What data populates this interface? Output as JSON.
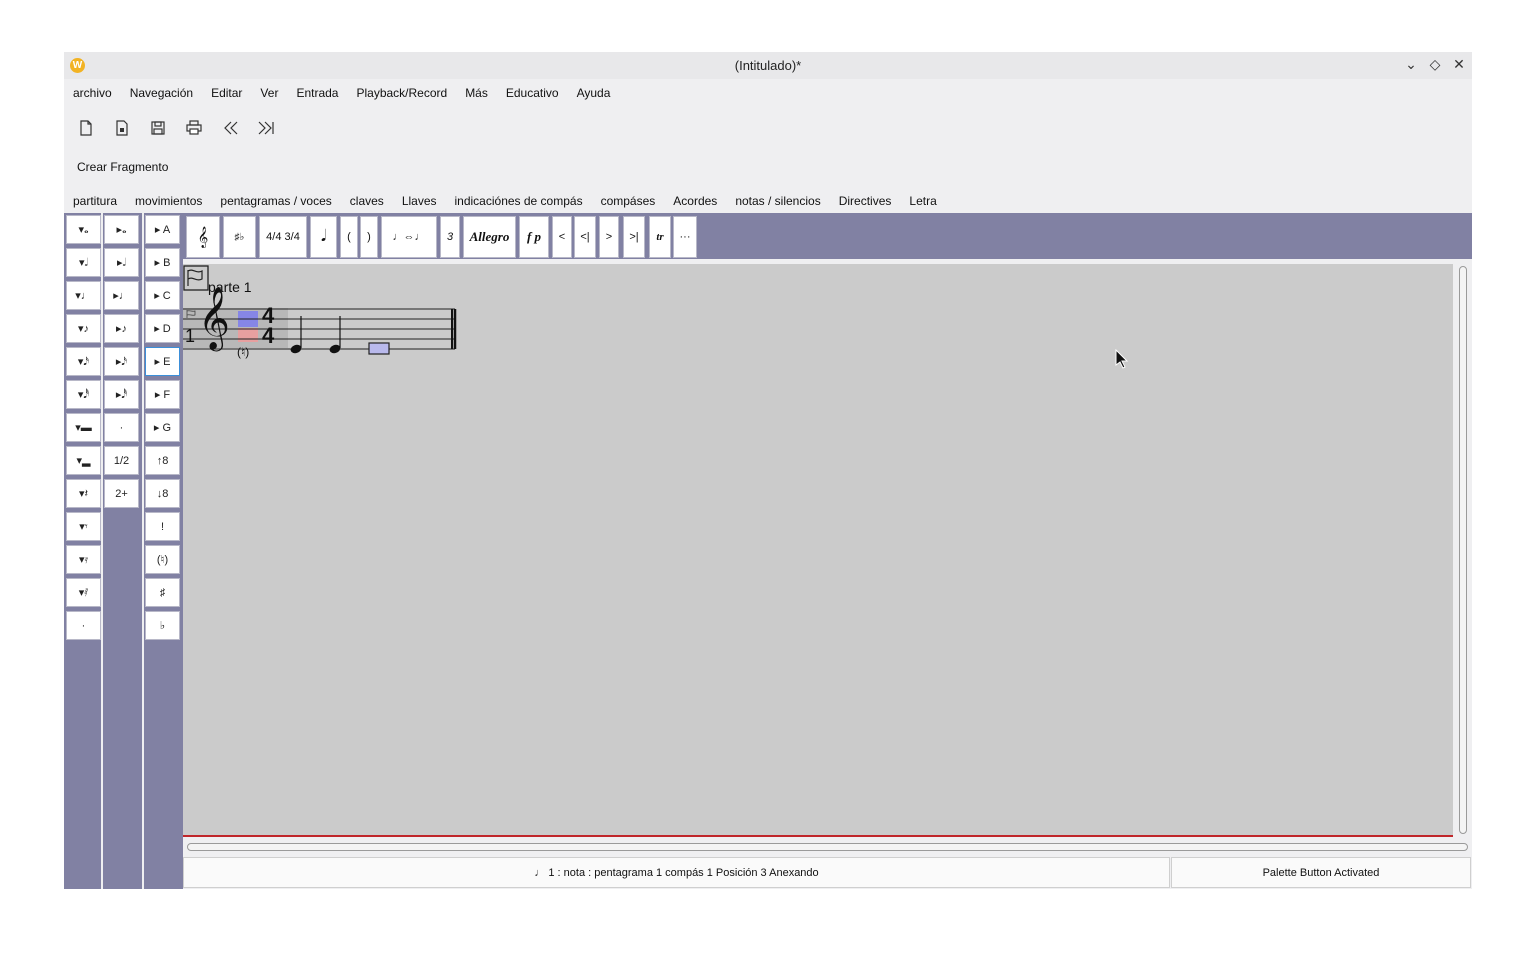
{
  "window": {
    "title": "(Intitulado)*"
  },
  "menu": [
    "archivo",
    "Navegación",
    "Editar",
    "Ver",
    "Entrada",
    "Playback/Record",
    "Más",
    "Educativo",
    "Ayuda"
  ],
  "toolbar_icons": [
    "new-file-icon",
    "open-file-icon",
    "save-icon",
    "print-icon",
    "go-first-icon",
    "go-last-icon"
  ],
  "fragment_button": "Crear Fragmento",
  "tabs": [
    "partitura",
    "movimientos",
    "pentagramas / voces",
    "claves",
    "Llaves",
    "indicaciónes de compás",
    "compáses",
    "Acordes",
    "notas / silencios",
    "Directives",
    "Letra"
  ],
  "palette": {
    "col1": [
      "▾𝅝",
      "▾𝅗𝅥",
      "▾♩",
      "▾♪",
      "▾𝅘𝅥𝅯",
      "▾𝅘𝅥𝅰",
      "▾▬",
      "▾▂",
      "▾𝄽",
      "▾𝄾",
      "▾𝄿",
      "▾𝅀",
      "·"
    ],
    "col2": [
      "▸𝅝",
      "▸𝅗𝅥",
      "▸♩",
      "▸♪",
      "▸𝅘𝅥𝅯",
      "▸𝅘𝅥𝅰",
      "·",
      "1/2",
      "2+"
    ],
    "col3": [
      "▸ A",
      "▸ B",
      "▸ C",
      "▸ D",
      "▸ E",
      "▸ F",
      "▸ G",
      "↑8",
      "↓8",
      "!",
      "(♮)",
      "♯",
      "♭"
    ]
  },
  "hpalette": [
    "𝄞",
    "♯♭",
    "4/4 3/4",
    "𝅘𝅥",
    "(",
    ")",
    "♩⇔♩",
    "3",
    "Allegro",
    "f p",
    "<",
    "<|",
    ">",
    ">|",
    "tr",
    "···"
  ],
  "score": {
    "part_label": "parte 1",
    "measure_number": "1",
    "time_sig_top": "4",
    "time_sig_bottom": "4",
    "natural_mark": "(♮)"
  },
  "status": {
    "left": "♩ 1 : nota : pentagrama 1 compás 1 Posición 3 Anexando",
    "right": "Palette Button Activated"
  }
}
